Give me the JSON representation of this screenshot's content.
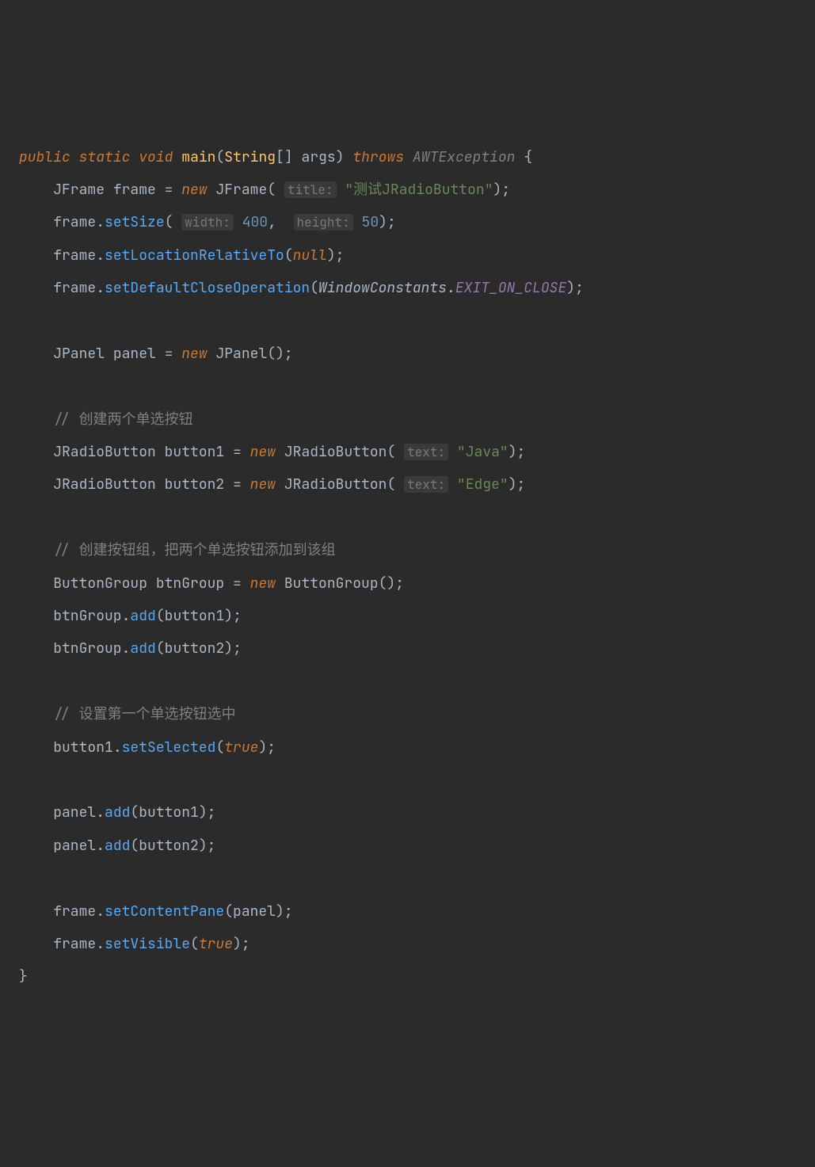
{
  "line1": {
    "public": "public",
    "static": "static",
    "void": "void",
    "main": "main",
    "lpar": "(",
    "string": "String",
    "brk": "[]",
    "args": "args",
    "rpar": ")",
    "throws": "throws",
    "exc": "AWTException",
    "lbrace": "{"
  },
  "line2": {
    "indent": "    ",
    "t1": "JFrame",
    "v": "frame",
    "eq": " = ",
    "new": "new",
    "t2": "JFrame",
    "lpar": "(",
    "hint": "title:",
    "str": "\"测试JRadioButton\"",
    "rpar": ")",
    "semi": ";"
  },
  "line3": {
    "indent": "    ",
    "obj": "frame",
    "dot": ".",
    "m": "setSize",
    "lpar": "(",
    "h1": "width:",
    "n1": "400",
    "comma": ", ",
    "h2": "height:",
    "n2": "50",
    "rpar": ")",
    "semi": ";"
  },
  "line4": {
    "indent": "    ",
    "obj": "frame",
    "dot": ".",
    "m": "setLocationRelativeTo",
    "lpar": "(",
    "null": "null",
    "rpar": ")",
    "semi": ";"
  },
  "line5": {
    "indent": "    ",
    "obj": "frame",
    "dot": ".",
    "m": "setDefaultCloseOperation",
    "lpar": "(",
    "cls": "WindowConstants",
    "dot2": ".",
    "fld": "EXIT_ON_CLOSE",
    "rpar": ")",
    "semi": ";"
  },
  "line6": {
    "blank": ""
  },
  "line7": {
    "indent": "    ",
    "t1": "JPanel",
    "v": "panel",
    "eq": " = ",
    "new": "new",
    "t2": "JPanel",
    "lpar": "(",
    "rpar": ")",
    "semi": ";"
  },
  "line8": {
    "blank": ""
  },
  "line9": {
    "indent": "    ",
    "c": "// 创建两个单选按钮"
  },
  "line10": {
    "indent": "    ",
    "t1": "JRadioButton",
    "v": "button1",
    "eq": " = ",
    "new": "new",
    "t2": "JRadioButton",
    "lpar": "(",
    "hint": "text:",
    "str": "\"Java\"",
    "rpar": ")",
    "semi": ";"
  },
  "line11": {
    "indent": "    ",
    "t1": "JRadioButton",
    "v": "button2",
    "eq": " = ",
    "new": "new",
    "t2": "JRadioButton",
    "lpar": "(",
    "hint": "text:",
    "str": "\"Edge\"",
    "rpar": ")",
    "semi": ";"
  },
  "line12": {
    "blank": ""
  },
  "line13": {
    "indent": "    ",
    "c": "// 创建按钮组，把两个单选按钮添加到该组"
  },
  "line14": {
    "indent": "    ",
    "t1": "ButtonGroup",
    "v": "btnGroup",
    "eq": " = ",
    "new": "new",
    "t2": "ButtonGroup",
    "lpar": "(",
    "rpar": ")",
    "semi": ";"
  },
  "line15": {
    "indent": "    ",
    "obj": "btnGroup",
    "dot": ".",
    "m": "add",
    "lpar": "(",
    "arg": "button1",
    "rpar": ")",
    "semi": ";"
  },
  "line16": {
    "indent": "    ",
    "obj": "btnGroup",
    "dot": ".",
    "m": "add",
    "lpar": "(",
    "arg": "button2",
    "rpar": ")",
    "semi": ";"
  },
  "line17": {
    "blank": ""
  },
  "line18": {
    "indent": "    ",
    "c": "// 设置第一个单选按钮选中"
  },
  "line19": {
    "indent": "    ",
    "obj": "button1",
    "dot": ".",
    "m": "setSelected",
    "lpar": "(",
    "true": "true",
    "rpar": ")",
    "semi": ";"
  },
  "line20": {
    "blank": ""
  },
  "line21": {
    "indent": "    ",
    "obj": "panel",
    "dot": ".",
    "m": "add",
    "lpar": "(",
    "arg": "button1",
    "rpar": ")",
    "semi": ";"
  },
  "line22": {
    "indent": "    ",
    "obj": "panel",
    "dot": ".",
    "m": "add",
    "lpar": "(",
    "arg": "button2",
    "rpar": ")",
    "semi": ";"
  },
  "line23": {
    "blank": ""
  },
  "line24": {
    "indent": "    ",
    "obj": "frame",
    "dot": ".",
    "m": "setContentPane",
    "lpar": "(",
    "arg": "panel",
    "rpar": ")",
    "semi": ";"
  },
  "line25": {
    "indent": "    ",
    "obj": "frame",
    "dot": ".",
    "m": "setVisible",
    "lpar": "(",
    "true": "true",
    "rpar": ")",
    "semi": ";"
  },
  "line26": {
    "rbrace": "}"
  }
}
